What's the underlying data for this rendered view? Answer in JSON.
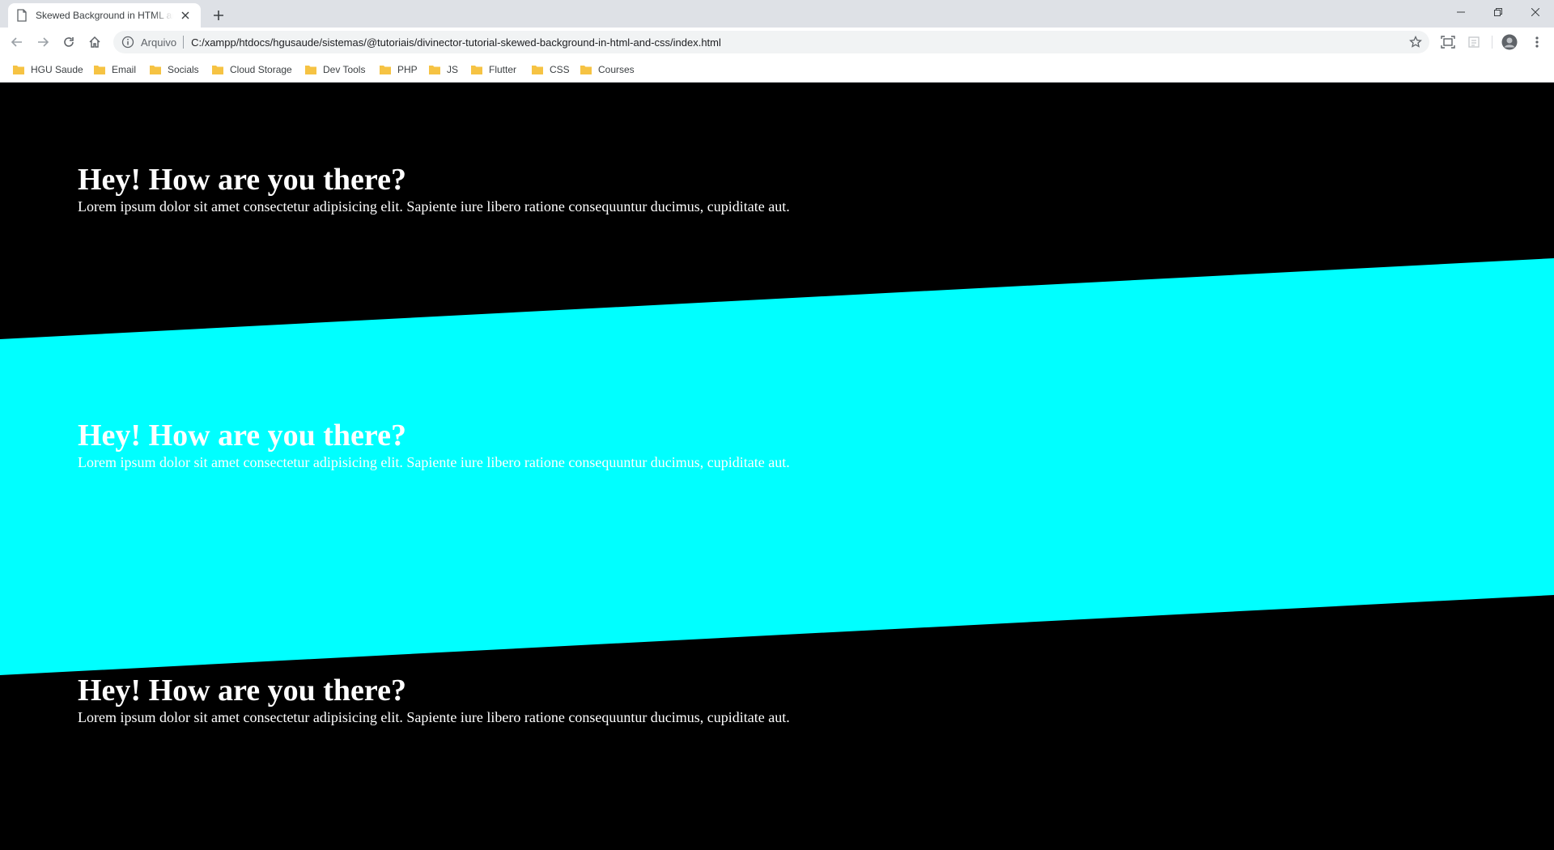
{
  "browser": {
    "tab_title": "Skewed Background in HTML and CSS",
    "address_scheme": "Arquivo",
    "address_url": "C:/xampp/htdocs/hgusaude/sistemas/@tutoriais/divinector-tutorial-skewed-background-in-html-and-css/index.html",
    "bookmarks": [
      "HGU Saude",
      "Email",
      "Socials",
      "Cloud Storage",
      "Dev Tools",
      "PHP",
      "JS",
      "Flutter",
      "CSS",
      "Courses"
    ]
  },
  "page": {
    "band_color": "#00ffff",
    "background_color": "#000000",
    "sections": [
      {
        "heading": "Hey! How are you there?",
        "text": "Lorem ipsum dolor sit amet consectetur adipisicing elit. Sapiente iure libero ratione consequuntur ducimus, cupiditate aut."
      },
      {
        "heading": "Hey! How are you there?",
        "text": "Lorem ipsum dolor sit amet consectetur adipisicing elit. Sapiente iure libero ratione consequuntur ducimus, cupiditate aut."
      },
      {
        "heading": "Hey! How are you there?",
        "text": "Lorem ipsum dolor sit amet consectetur adipisicing elit. Sapiente iure libero ratione consequuntur ducimus, cupiditate aut."
      }
    ]
  }
}
